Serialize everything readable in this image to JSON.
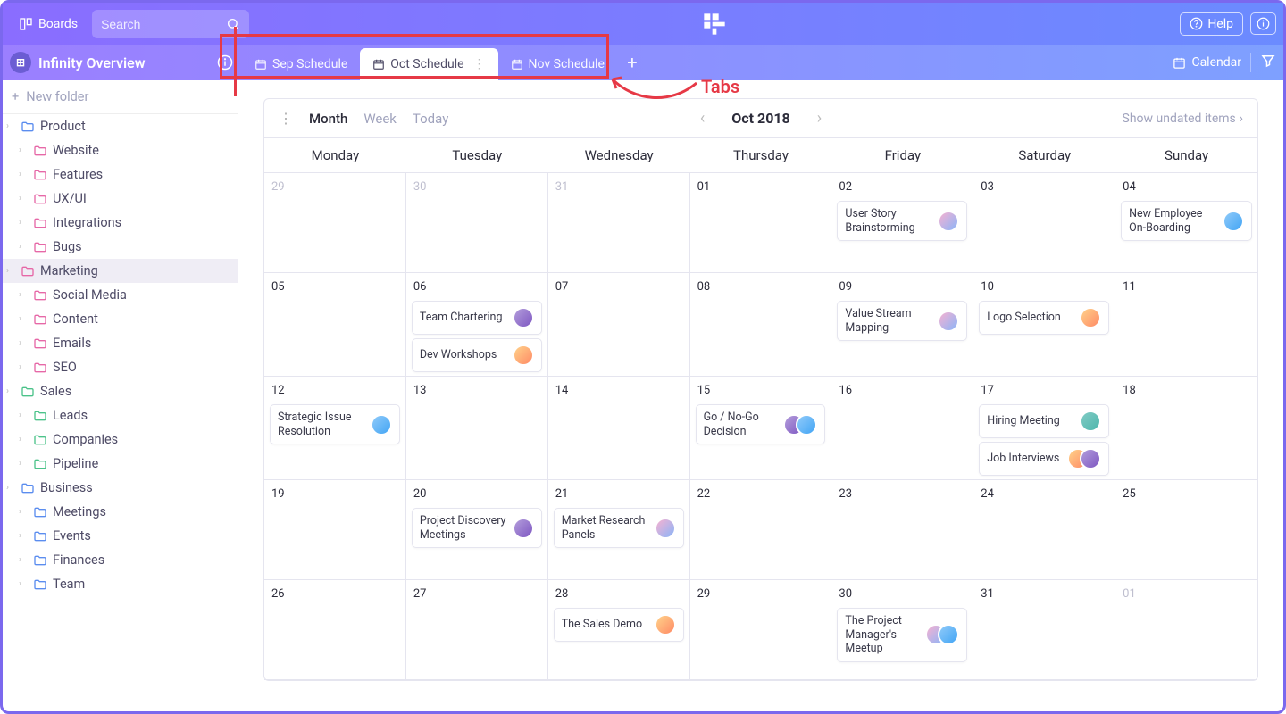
{
  "topbar": {
    "boards_label": "Boards",
    "search_placeholder": "Search",
    "help_label": "Help"
  },
  "workspace": {
    "title": "Infinity Overview"
  },
  "tabs": [
    {
      "label": "Sep Schedule",
      "active": false
    },
    {
      "label": "Oct Schedule",
      "active": true
    },
    {
      "label": "Nov Schedule",
      "active": false
    }
  ],
  "view_button": "Calendar",
  "sidebar": {
    "new_folder": "New folder",
    "items": [
      {
        "label": "Product",
        "color": "blue",
        "level": 0
      },
      {
        "label": "Website",
        "color": "pink",
        "level": 1
      },
      {
        "label": "Features",
        "color": "pink",
        "level": 1
      },
      {
        "label": "UX/UI",
        "color": "pink",
        "level": 1
      },
      {
        "label": "Integrations",
        "color": "pink",
        "level": 1
      },
      {
        "label": "Bugs",
        "color": "pink",
        "level": 1
      },
      {
        "label": "Marketing",
        "color": "pink",
        "level": 0,
        "selected": true
      },
      {
        "label": "Social Media",
        "color": "pink",
        "level": 1
      },
      {
        "label": "Content",
        "color": "pink",
        "level": 1
      },
      {
        "label": "Emails",
        "color": "pink",
        "level": 1
      },
      {
        "label": "SEO",
        "color": "pink",
        "level": 1
      },
      {
        "label": "Sales",
        "color": "green",
        "level": 0
      },
      {
        "label": "Leads",
        "color": "green",
        "level": 1
      },
      {
        "label": "Companies",
        "color": "green",
        "level": 1
      },
      {
        "label": "Pipeline",
        "color": "green",
        "level": 1
      },
      {
        "label": "Business",
        "color": "blue",
        "level": 0
      },
      {
        "label": "Meetings",
        "color": "blue",
        "level": 1
      },
      {
        "label": "Events",
        "color": "blue",
        "level": 1
      },
      {
        "label": "Finances",
        "color": "blue",
        "level": 1
      },
      {
        "label": "Team",
        "color": "blue",
        "level": 1
      }
    ]
  },
  "calendar": {
    "modes": [
      "Month",
      "Week",
      "Today"
    ],
    "active_mode": "Month",
    "title": "Oct 2018",
    "undated_label": "Show undated items",
    "weekdays": [
      "Monday",
      "Tuesday",
      "Wednesday",
      "Thursday",
      "Friday",
      "Saturday",
      "Sunday"
    ],
    "cells": [
      {
        "n": "29",
        "muted": true
      },
      {
        "n": "30",
        "muted": true
      },
      {
        "n": "31",
        "muted": true
      },
      {
        "n": "01"
      },
      {
        "n": "02",
        "events": [
          {
            "t": "User Story Brainstorming",
            "a": [
              "a1"
            ]
          }
        ]
      },
      {
        "n": "03"
      },
      {
        "n": "04",
        "events": [
          {
            "t": "New Employee On-Boarding",
            "a": [
              "a5"
            ]
          }
        ]
      },
      {
        "n": "05"
      },
      {
        "n": "06",
        "events": [
          {
            "t": "Team Chartering",
            "a": [
              "a3"
            ]
          },
          {
            "t": "Dev Workshops",
            "a": [
              "a2"
            ]
          }
        ]
      },
      {
        "n": "07"
      },
      {
        "n": "08"
      },
      {
        "n": "09",
        "events": [
          {
            "t": "Value Stream Mapping",
            "a": [
              "a1"
            ]
          }
        ]
      },
      {
        "n": "10",
        "events": [
          {
            "t": "Logo Selection",
            "a": [
              "a2"
            ]
          }
        ]
      },
      {
        "n": "11"
      },
      {
        "n": "12",
        "events": [
          {
            "t": "Strategic Issue Resolution",
            "a": [
              "a5"
            ]
          }
        ]
      },
      {
        "n": "13"
      },
      {
        "n": "14"
      },
      {
        "n": "15",
        "events": [
          {
            "t": "Go / No-Go Decision",
            "a": [
              "a3",
              "a5"
            ]
          }
        ]
      },
      {
        "n": "16"
      },
      {
        "n": "17",
        "events": [
          {
            "t": "Hiring Meeting",
            "a": [
              "a4"
            ]
          },
          {
            "t": "Job Interviews",
            "a": [
              "a2",
              "a3"
            ]
          }
        ]
      },
      {
        "n": "18"
      },
      {
        "n": "19"
      },
      {
        "n": "20",
        "events": [
          {
            "t": "Project Discovery Meetings",
            "a": [
              "a3"
            ]
          }
        ]
      },
      {
        "n": "21",
        "events": [
          {
            "t": "Market Research Panels",
            "a": [
              "a1"
            ]
          }
        ]
      },
      {
        "n": "22"
      },
      {
        "n": "23"
      },
      {
        "n": "24"
      },
      {
        "n": "25"
      },
      {
        "n": "26"
      },
      {
        "n": "27"
      },
      {
        "n": "28",
        "events": [
          {
            "t": "The Sales Demo",
            "a": [
              "a2"
            ]
          }
        ]
      },
      {
        "n": "29"
      },
      {
        "n": "30",
        "events": [
          {
            "t": "The Project Manager's Meetup",
            "a": [
              "a1",
              "a5"
            ]
          }
        ]
      },
      {
        "n": "31"
      },
      {
        "n": "01",
        "muted": true
      }
    ]
  },
  "annotation": {
    "label": "Tabs"
  }
}
